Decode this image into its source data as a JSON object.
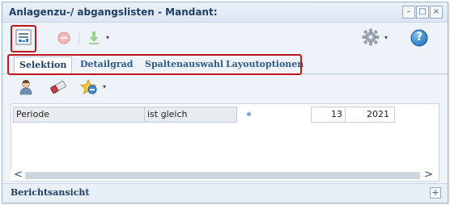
{
  "window": {
    "title": "Anlagenzu-/ abgangslisten - Mandant:",
    "controls": {
      "minimize": "–",
      "maximize": "□",
      "close": "×"
    }
  },
  "toolbar": {
    "icons": [
      "report-list-icon",
      "stop-icon",
      "download-icon",
      "gear-icon",
      "help-icon"
    ],
    "help_glyph": "?",
    "caret": "▾"
  },
  "tabs": [
    {
      "label": "Selektion",
      "active": true
    },
    {
      "label": "Detailgrad",
      "active": false
    },
    {
      "label": "Spaltenauswahl",
      "active": false
    },
    {
      "label": "Layoutoptionen",
      "active": false
    }
  ],
  "subtoolbar": {
    "icons": [
      "user-icon",
      "eraser-icon",
      "favorites-icon"
    ],
    "caret": "▾"
  },
  "filter_row": {
    "field": "Periode",
    "operator": "ist gleich",
    "period": "13",
    "year": "2021"
  },
  "scrollbar": {
    "left": "<",
    "right": ">"
  },
  "footer": {
    "label": "Berichtsansicht",
    "expand": "+"
  },
  "colors": {
    "highlight_border": "#c0161d",
    "title_text": "#1f3f66",
    "window_bg": "#eef3f9"
  }
}
